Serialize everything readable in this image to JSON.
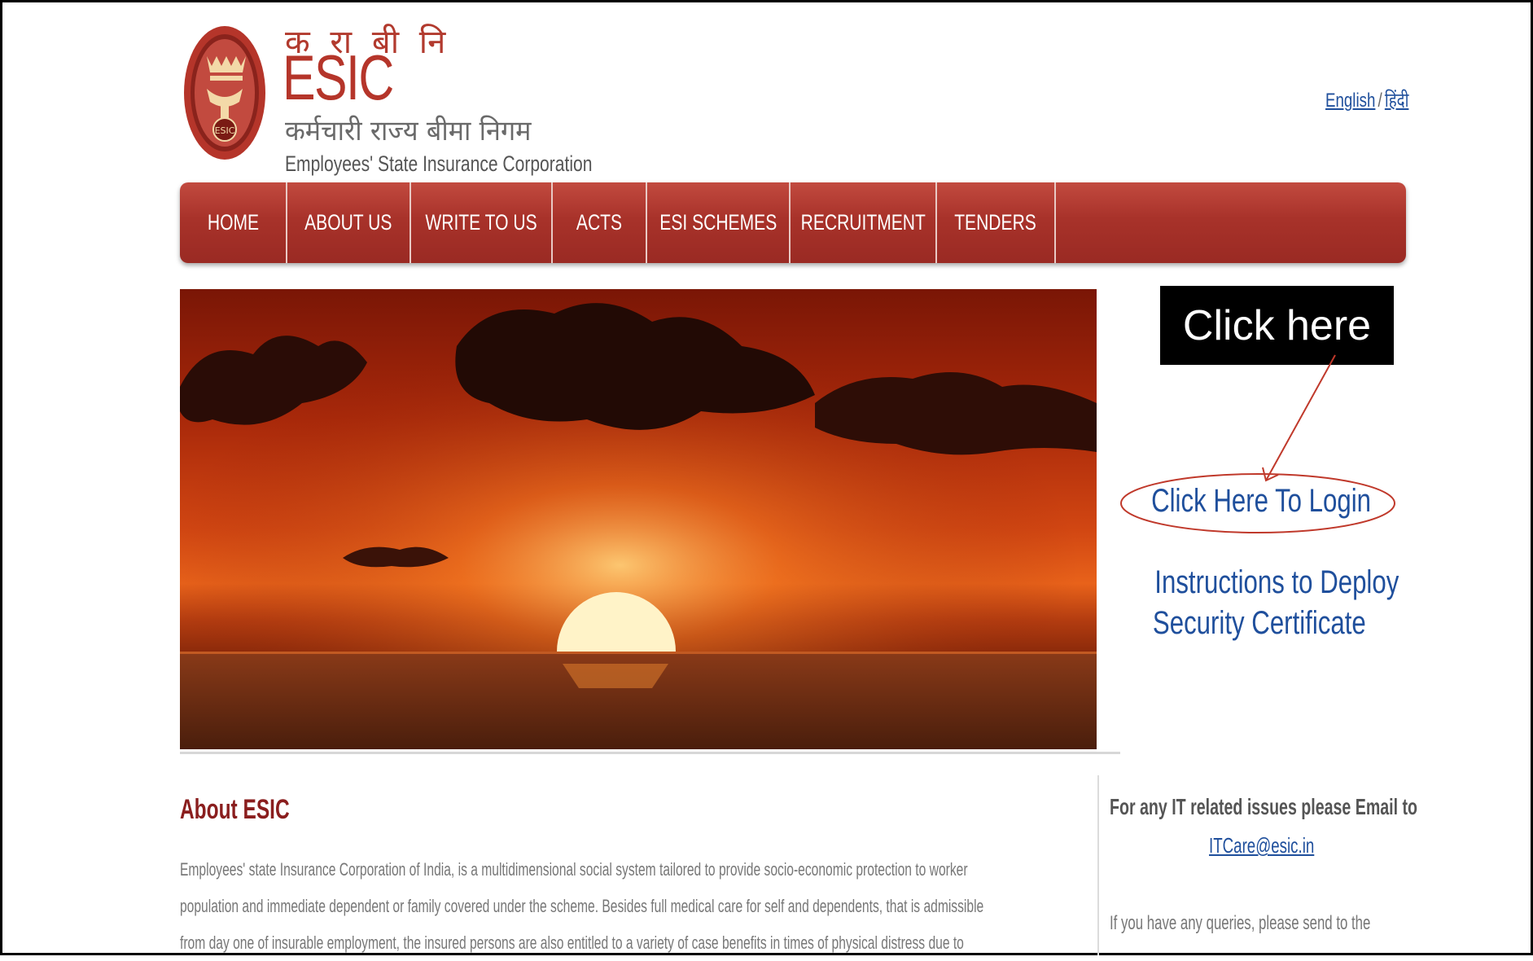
{
  "brand": {
    "hindi_abbr": "क रा बी नि",
    "abbr": "ESIC",
    "hindi_full": "कर्मचारी राज्य बीमा निगम",
    "english_full": "Employees' State Insurance Corporation",
    "logo_text": "ESIC",
    "primary_color": "#b5352a"
  },
  "language": {
    "english": "English",
    "separator": "/",
    "hindi": "हिंदी"
  },
  "nav": {
    "items": [
      {
        "label": "HOME"
      },
      {
        "label": "ABOUT US"
      },
      {
        "label": "WRITE TO US"
      },
      {
        "label": "ACTS"
      },
      {
        "label": "ESI SCHEMES"
      },
      {
        "label": "RECRUITMENT"
      },
      {
        "label": "TENDERS"
      }
    ]
  },
  "callout": {
    "text": "Click here"
  },
  "login": {
    "link": "Click Here To Login",
    "instructions_line1": "Instructions to Deploy",
    "instructions_line2": "Security Certificate"
  },
  "about": {
    "title": "About ESIC",
    "lines": [
      "Employees' state Insurance Corporation of India,  is a multidimensional social system tailored to provide socio-economic  protection to worker",
      "population and immediate dependent or family covered under the scheme.  Besides full medical care for self and dependents, that is admissible",
      "from day  one of insurable employment, the insured persons are also entitled to a variety  of case benefits in times of physical distress due to"
    ]
  },
  "it_support": {
    "title": "For any IT related issues please Email to",
    "email": "ITCare@esic.in",
    "query": "If you have any queries, please send to the"
  }
}
